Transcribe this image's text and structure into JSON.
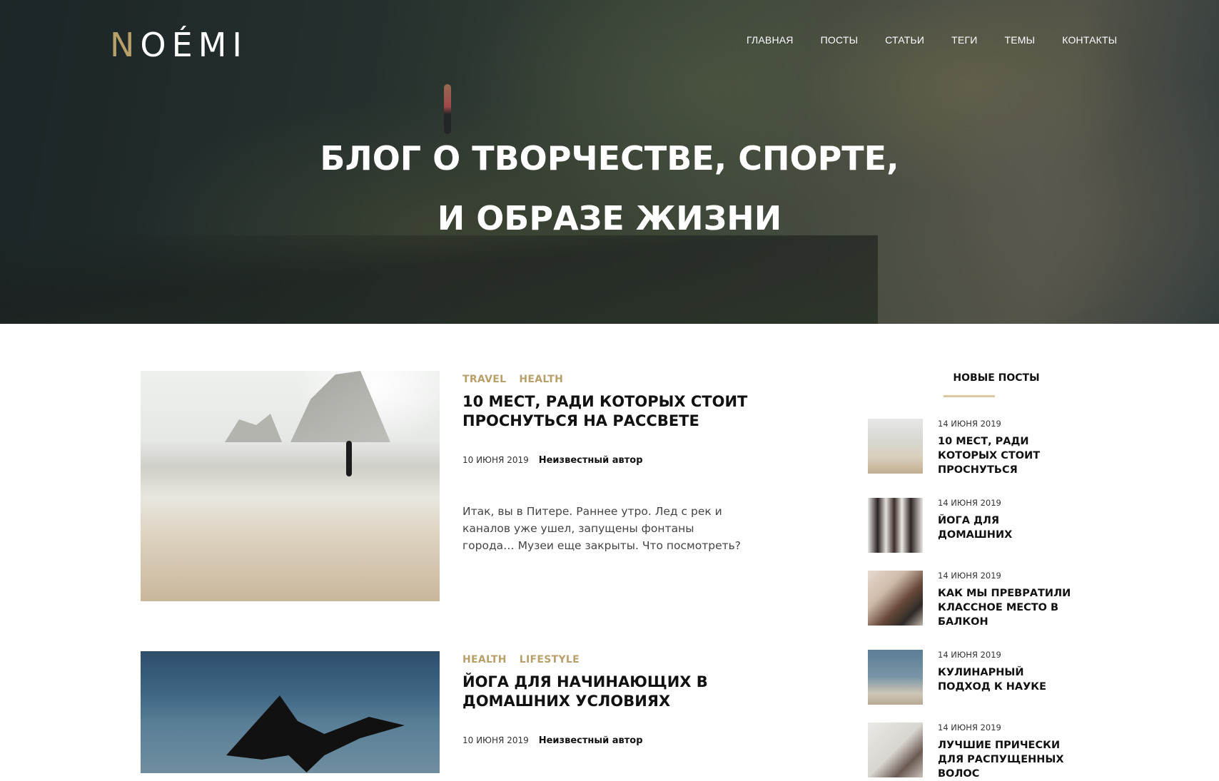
{
  "header": {
    "logo_first": "N",
    "logo_rest": "OÉMI",
    "nav": [
      "ГЛАВНАЯ",
      "ПОСТЫ",
      "СТАТЬИ",
      "ТЕГИ",
      "ТЕМЫ",
      "КОНТАКТЫ"
    ],
    "hero_title_line1": "БЛОГ О ТВОРЧЕСТВЕ, СПОРТЕ,",
    "hero_title_line2": "И ОБРАЗЕ ЖИЗНИ"
  },
  "posts": [
    {
      "tags": [
        "TRAVEL",
        "HEALTH"
      ],
      "title": "10 МЕСТ, РАДИ КОТОРЫХ СТОИТ ПРОСНУТЬСЯ НА РАССВЕТЕ",
      "date": "10 ИЮНЯ 2019",
      "author": "Неизвестный автор",
      "excerpt": "Итак, вы в Питере. Раннее утро. Лед с рек и каналов уже ушел, запущены фонтаны города… Музеи еще закрыты. Что посмотреть?"
    },
    {
      "tags": [
        "HEALTH",
        "LIFESTYLE"
      ],
      "title": "ЙОГА ДЛЯ НАЧИНАЮЩИХ В ДОМАШНИХ УСЛОВИЯХ",
      "date": "10 ИЮНЯ 2019",
      "author": "Неизвестный автор"
    }
  ],
  "sidebar": {
    "title": "НОВЫЕ ПОСТЫ",
    "items": [
      {
        "date": "14 ИЮНЯ 2019",
        "title": "10 МЕСТ, РАДИ КОТОРЫХ СТОИТ ПРОСНУТЬСЯ"
      },
      {
        "date": "14 ИЮНЯ 2019",
        "title": "ЙОГА ДЛЯ ДОМАШНИХ"
      },
      {
        "date": "14 ИЮНЯ 2019",
        "title": "КАК МЫ ПРЕВРАТИЛИ КЛАССНОЕ МЕСТО В БАЛКОН"
      },
      {
        "date": "14 ИЮНЯ 2019",
        "title": "КУЛИНАРНЫЙ ПОДХОД К НАУКЕ"
      },
      {
        "date": "14 ИЮНЯ 2019",
        "title": "ЛУЧШИЕ ПРИЧЕСКИ ДЛЯ РАСПУЩЕННЫХ ВОЛОС"
      }
    ]
  },
  "colors": {
    "accent": "#b8a06a",
    "text": "#111111",
    "rule": "#d8c9a4"
  }
}
